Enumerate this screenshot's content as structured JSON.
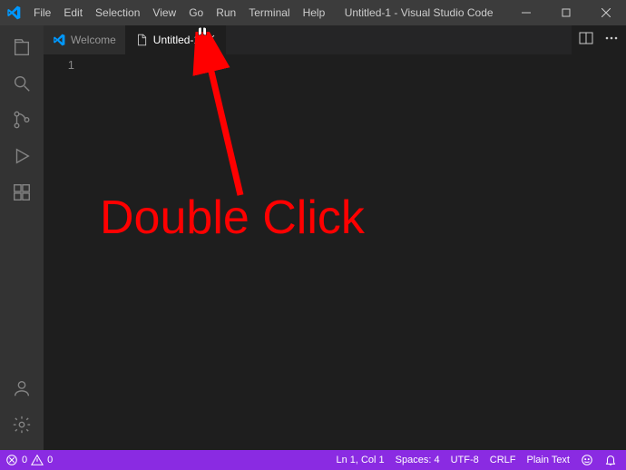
{
  "titlebar": {
    "title": "Untitled-1 - Visual Studio Code"
  },
  "menu": {
    "file": "File",
    "edit": "Edit",
    "selection": "Selection",
    "view": "View",
    "go": "Go",
    "run": "Run",
    "terminal": "Terminal",
    "help": "Help"
  },
  "tabs": {
    "welcome": "Welcome",
    "untitled": "Untitled-1"
  },
  "gutter": {
    "line1": "1"
  },
  "status": {
    "errors": "0",
    "warnings": "0",
    "position": "Ln 1, Col 1",
    "spaces": "Spaces: 4",
    "encoding": "UTF-8",
    "eol": "CRLF",
    "language": "Plain Text"
  },
  "annotation": {
    "text": "Double Click"
  }
}
